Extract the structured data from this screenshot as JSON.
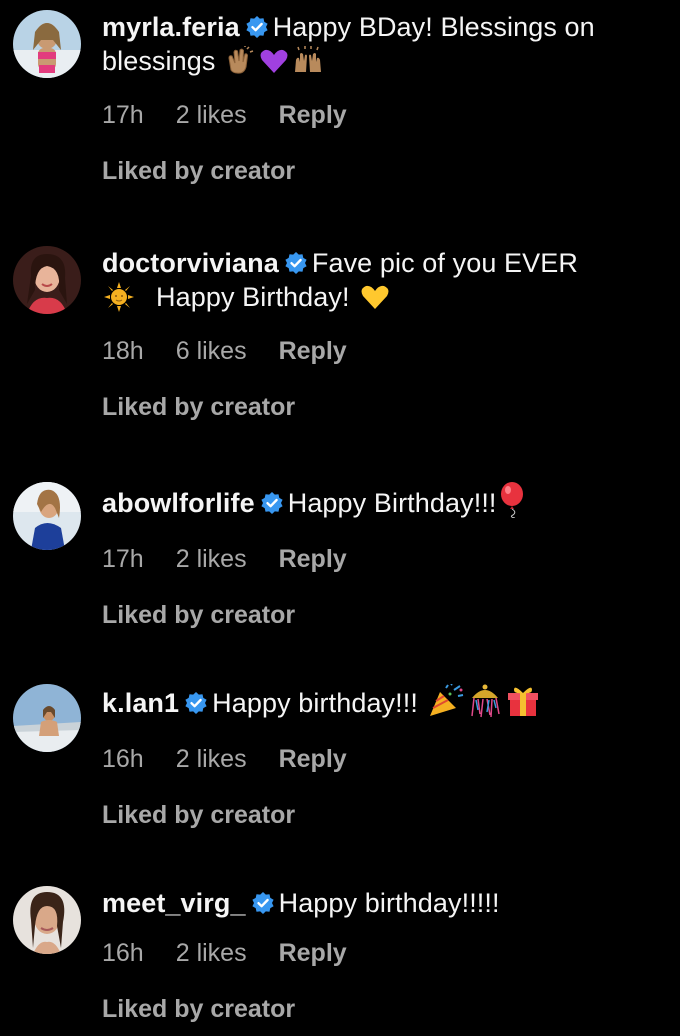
{
  "comments": [
    {
      "username": "myrla.feria",
      "text": "Happy BDay! Blessings on blessings",
      "emojis": [
        "clapping-hands-emoji",
        "purple-heart-emoji",
        "raising-hands-emoji"
      ],
      "time": "17h",
      "likes": "2 likes",
      "reply": "Reply",
      "liked_by": "Liked by creator"
    },
    {
      "username": "doctorviviana",
      "text": "Fave pic of you EVER",
      "text2": "Happy Birthday!",
      "emojis": [
        "sun-emoji",
        "yellow-heart-emoji"
      ],
      "time": "18h",
      "likes": "6 likes",
      "reply": "Reply",
      "liked_by": "Liked by creator"
    },
    {
      "username": "abowlforlife",
      "text": "Happy Birthday!!!",
      "emojis": [
        "balloon-emoji"
      ],
      "time": "17h",
      "likes": "2 likes",
      "reply": "Reply",
      "liked_by": "Liked by creator"
    },
    {
      "username": "k.lan1",
      "text": "Happy birthday!!!",
      "emojis": [
        "party-popper-emoji",
        "confetti-ball-emoji",
        "gift-emoji"
      ],
      "time": "16h",
      "likes": "2 likes",
      "reply": "Reply",
      "liked_by": "Liked by creator"
    },
    {
      "username": "meet_virg_",
      "text": "Happy birthday!!!!!",
      "emojis": [],
      "time": "16h",
      "likes": "2 likes",
      "reply": "Reply",
      "liked_by": "Liked by creator"
    }
  ],
  "colors": {
    "background": "#000000",
    "text": "#f5f5f5",
    "secondary": "#a8a8a8",
    "verified": "#3897f0"
  }
}
